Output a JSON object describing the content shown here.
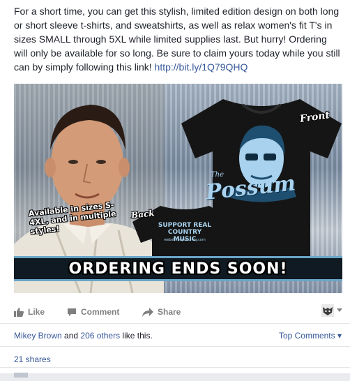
{
  "post": {
    "text_main": "For a short time, you can get this stylish, limited edition design on both long or short sleeve t-shirts, and sweatshirts, as well as relax women's fit T's in sizes SMALL through 5XL while limited supplies last. But hurry! Ordering will only be available for so long. Be sure to claim yours today while you still can by simply following this link! ",
    "link": "http://bit.ly/1Q79QHQ"
  },
  "image": {
    "front_label": "Front",
    "back_label": "Back",
    "sizes_note": "Available in sizes S-4XL, and in multiple styles!",
    "possum_small": "The",
    "possum": "Possum",
    "back_text": "SUPPORT REAL COUNTRY MUSIC",
    "back_url": "websitepopcountry.com",
    "banner": "ORDERING ENDS SOON!"
  },
  "actions": {
    "like": "Like",
    "comment": "Comment",
    "share": "Share"
  },
  "likes": {
    "name": "Mikey Brown",
    "and": " and ",
    "others": "206 others",
    "suffix": " like this."
  },
  "top_comments": "Top Comments ▾",
  "shares": "21 shares",
  "colors": {
    "link": "#365899",
    "muted": "#7f7f7f",
    "banner_bg": "#0f1a22",
    "possum_blue": "#a8d2ee"
  }
}
